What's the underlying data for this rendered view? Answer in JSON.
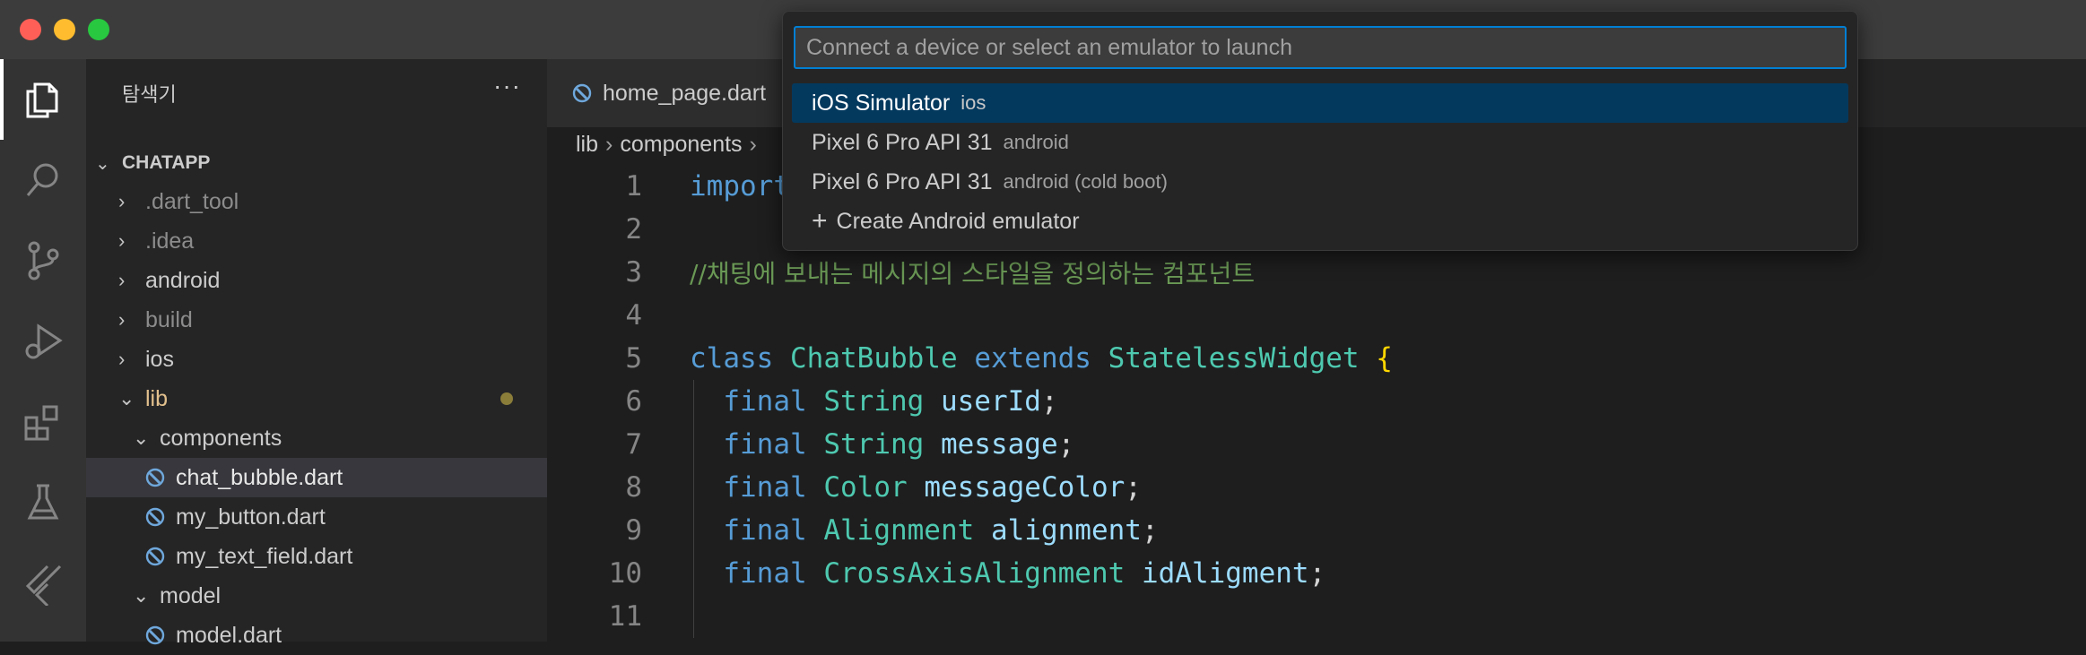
{
  "window": {
    "traffic_lights": {
      "close_color": "#ff5f57",
      "minimize_color": "#febc2e",
      "zoom_color": "#28c840"
    }
  },
  "activity_bar": {
    "items": [
      {
        "name": "explorer-icon",
        "active": true
      },
      {
        "name": "search-icon",
        "active": false
      },
      {
        "name": "source-control-icon",
        "active": false
      },
      {
        "name": "run-debug-icon",
        "active": false
      },
      {
        "name": "extensions-icon",
        "active": false
      },
      {
        "name": "testing-icon",
        "active": false
      },
      {
        "name": "flutter-icon",
        "active": false
      }
    ]
  },
  "sidebar": {
    "title": "탐색기",
    "more_label": "···",
    "project": "CHATAPP",
    "tree": [
      {
        "label": ".dart_tool",
        "chevron": "›",
        "muted": true
      },
      {
        "label": ".idea",
        "chevron": "›",
        "muted": true
      },
      {
        "label": "android",
        "chevron": "›",
        "muted": false
      },
      {
        "label": "build",
        "chevron": "›",
        "muted": true
      },
      {
        "label": "ios",
        "chevron": "›",
        "muted": false
      },
      {
        "label": "lib",
        "chevron": "⌄",
        "muted": false,
        "modified": true
      },
      {
        "label": "components",
        "chevron": "⌄",
        "muted": false
      },
      {
        "label": "chat_bubble.dart",
        "file": true,
        "selected": true
      },
      {
        "label": "my_button.dart",
        "file": true
      },
      {
        "label": "my_text_field.dart",
        "file": true
      },
      {
        "label": "model",
        "chevron": "⌄",
        "muted": false
      },
      {
        "label": "model.dart",
        "file": true
      }
    ]
  },
  "editor": {
    "tab_label": "home_page.dart",
    "breadcrumb": [
      "lib",
      "components"
    ],
    "breadcrumb_sep": "›",
    "line_numbers": [
      "1",
      "2",
      "3",
      "4",
      "5",
      "6",
      "7",
      "8",
      "9",
      "10",
      "11"
    ],
    "line1_keyword": "import",
    "line3_comment": "//채팅에 보내는 메시지의 스타일을 정의하는 컴포넌트",
    "line5": {
      "class_kw": "class",
      "name": "ChatBubble",
      "extends_kw": "extends",
      "parent": "StatelessWidget",
      "brace": "{"
    },
    "fields": [
      {
        "kw": "final",
        "type": "String",
        "name": "userId",
        "semi": ";"
      },
      {
        "kw": "final",
        "type": "String",
        "name": "message",
        "semi": ";"
      },
      {
        "kw": "final",
        "type": "Color",
        "name": "messageColor",
        "semi": ";"
      },
      {
        "kw": "final",
        "type": "Alignment",
        "name": "alignment",
        "semi": ";"
      },
      {
        "kw": "final",
        "type": "CrossAxisAlignment",
        "name": "idAligment",
        "semi": ";"
      }
    ]
  },
  "quick_pick": {
    "placeholder": "Connect a device or select an emulator to launch",
    "items": [
      {
        "label": "iOS Simulator",
        "desc": "ios",
        "selected": true
      },
      {
        "label": "Pixel 6 Pro API 31",
        "desc": "android"
      },
      {
        "label": "Pixel 6 Pro API 31",
        "desc": "android (cold boot)"
      }
    ],
    "create": {
      "icon": "+",
      "label": "Create Android emulator"
    }
  }
}
